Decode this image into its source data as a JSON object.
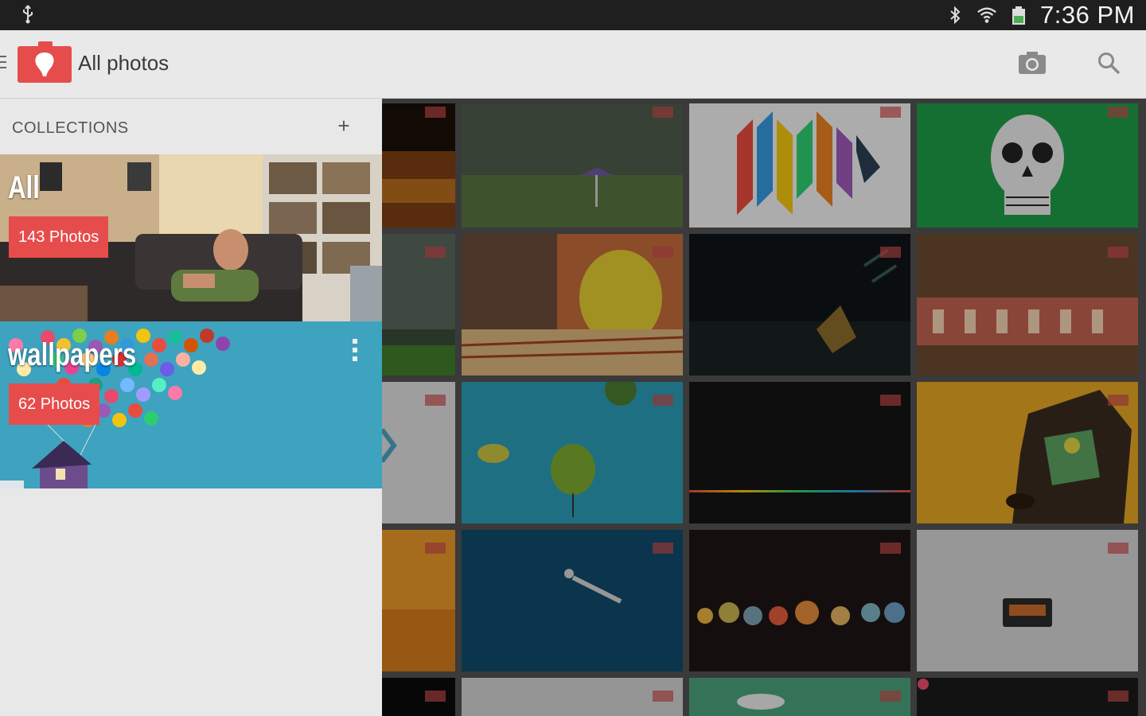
{
  "status_bar": {
    "time": "7:36 PM",
    "icons": [
      "usb-icon",
      "bluetooth-icon",
      "wifi-icon",
      "battery-icon"
    ]
  },
  "app_bar": {
    "title": "All photos",
    "actions": [
      "camera-icon",
      "search-icon"
    ]
  },
  "collections": {
    "header": "COLLECTIONS",
    "add_label": "+",
    "items": [
      {
        "name": "All",
        "count": "143 Photos"
      },
      {
        "name": "wallpapers",
        "count": "62 Photos"
      }
    ]
  },
  "colors": {
    "accent": "#e74c4c",
    "appbar_bg": "#e9e9e9",
    "statusbar_bg": "#1f1f1f"
  }
}
